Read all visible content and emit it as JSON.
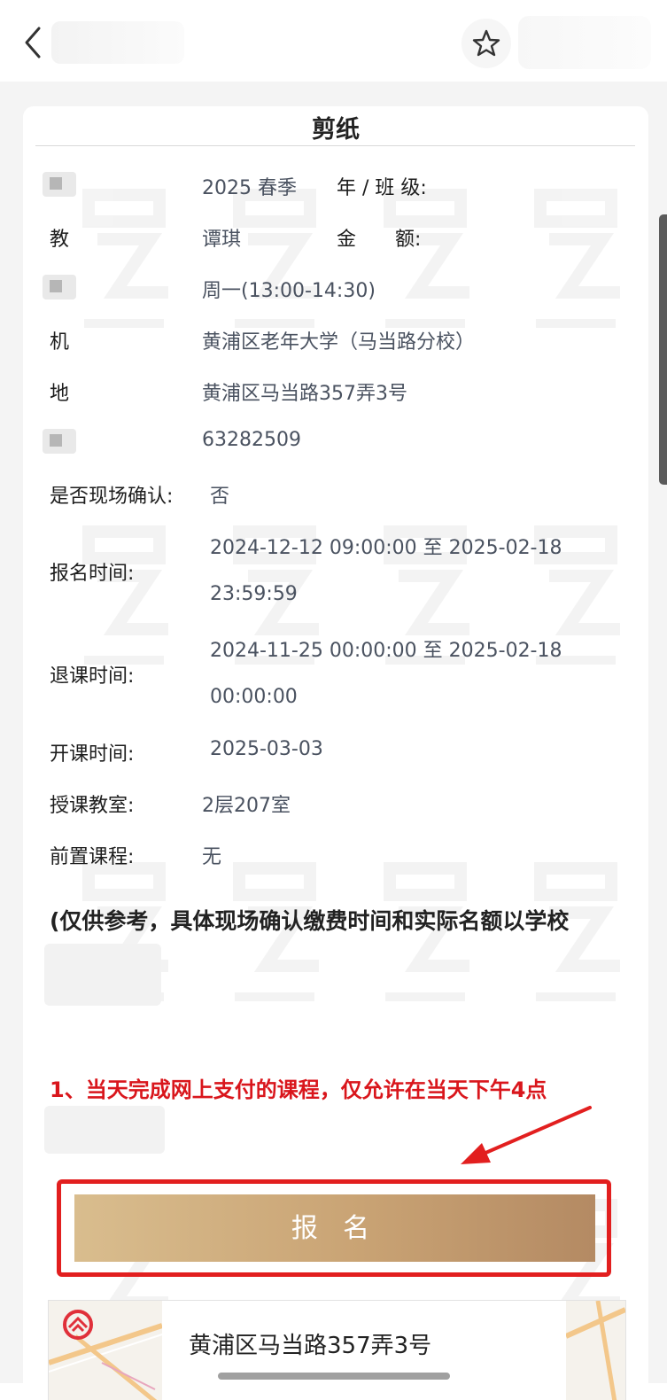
{
  "card": {
    "title": "剪纸",
    "rows": {
      "term": {
        "value": "2025 春季",
        "suffix": "年 / 班 级:"
      },
      "teacher": {
        "label": "教",
        "value": "谭琪",
        "suffix": "金　　额:"
      },
      "time": {
        "value": "周一(13:00-14:30)"
      },
      "org": {
        "label": "机",
        "value": "黄浦区老年大学（马当路分校）"
      },
      "address": {
        "label": "地",
        "value": "黄浦区马当路357弄3号"
      },
      "phone": {
        "value": "63282509"
      },
      "onsite": {
        "label": "是否现场确认:",
        "value": "否"
      },
      "enroll_time": {
        "label": "报名时间:",
        "line1": "2024-12-12 09:00:00 至 2025-02-18",
        "line2": "23:59:59"
      },
      "withdraw_time": {
        "label": "退课时间:",
        "line1": "2024-11-25 00:00:00 至 2025-02-18",
        "line2": "00:00:00"
      },
      "start_date": {
        "label": "开课时间:",
        "value": "2025-03-03"
      },
      "classroom": {
        "label": "授课教室:",
        "value": "2层207室"
      },
      "prereq": {
        "label": "前置课程:",
        "value": "无"
      }
    },
    "note": "(仅供参考，具体现场确认缴费时间和实际名额以学校",
    "red_note": "1、当天完成网上支付的课程，仅允许在当天下午4点",
    "signup_label": "报 名",
    "map_address": "黄浦区马当路357弄3号"
  },
  "colors": {
    "red": "#d9161c",
    "button_gold_start": "#d9bd8e",
    "button_gold_end": "#b48a63",
    "highlight_border": "#e21f1f",
    "metro_logo": "#e0303a"
  },
  "icons": {
    "back": "chevron-left",
    "favorite": "star-outline",
    "metro": "shanghai-metro-logo",
    "annotation": "red-arrow"
  }
}
